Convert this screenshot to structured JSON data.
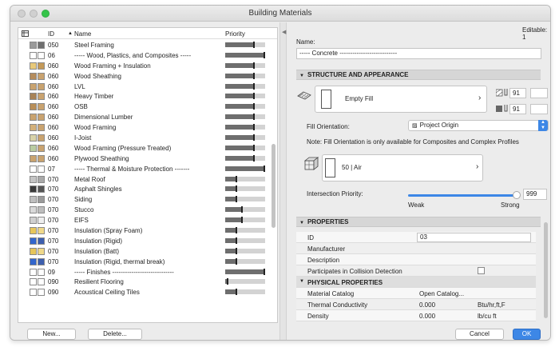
{
  "window": {
    "title": "Building Materials"
  },
  "list": {
    "headers": {
      "id": "ID",
      "name": "Name",
      "priority": "Priority"
    },
    "rows": [
      {
        "id": "050",
        "name": "Steel Framing",
        "c1": "#9a9a9a",
        "c2": "#6f6f6f",
        "p": 0.72
      },
      {
        "id": "06",
        "name": "----- Wood, Plastics, and Composites -----",
        "c1": "#ffffff",
        "c2": "#ffffff",
        "p": 0.98
      },
      {
        "id": "060",
        "name": "Wood Framing + Insulation",
        "c1": "#e8c97a",
        "c2": "#c49a59",
        "p": 0.72
      },
      {
        "id": "060",
        "name": "Wood Sheathing",
        "c1": "#b58c5c",
        "c2": "#c9a36f",
        "p": 0.72
      },
      {
        "id": "060",
        "name": "LVL",
        "c1": "#c9a36f",
        "c2": "#c9a36f",
        "p": 0.72
      },
      {
        "id": "060",
        "name": "Heavy Timber",
        "c1": "#a88256",
        "c2": "#c9a36f",
        "p": 0.72
      },
      {
        "id": "060",
        "name": "OSB",
        "c1": "#b98f59",
        "c2": "#c9a36f",
        "p": 0.72
      },
      {
        "id": "060",
        "name": "Dimensional Lumber",
        "c1": "#c9a36f",
        "c2": "#c9a36f",
        "p": 0.72
      },
      {
        "id": "060",
        "name": "Wood Framing",
        "c1": "#d3b07a",
        "c2": "#c9a36f",
        "p": 0.72
      },
      {
        "id": "060",
        "name": "I-Joist",
        "c1": "#d8d2a8",
        "c2": "#c9a36f",
        "p": 0.72
      },
      {
        "id": "060",
        "name": "Wood Framing (Pressure Treated)",
        "c1": "#b9cca1",
        "c2": "#c9a36f",
        "p": 0.72
      },
      {
        "id": "060",
        "name": "Plywood Sheathing",
        "c1": "#c9a36f",
        "c2": "#c9a36f",
        "p": 0.72
      },
      {
        "id": "07",
        "name": "----- Thermal & Moisture Protection -------",
        "c1": "#ffffff",
        "c2": "#ffffff",
        "p": 0.98
      },
      {
        "id": "070",
        "name": "Metal Roof",
        "c1": "#c4c4c4",
        "c2": "#a9a9a9",
        "p": 0.28
      },
      {
        "id": "070",
        "name": "Asphalt Shingles",
        "c1": "#3b3b3b",
        "c2": "#555555",
        "p": 0.28
      },
      {
        "id": "070",
        "name": "Siding",
        "c1": "#bfbfbf",
        "c2": "#9a9a9a",
        "p": 0.28
      },
      {
        "id": "070",
        "name": "Stucco",
        "c1": "#d9d9d9",
        "c2": "#bdbdbd",
        "p": 0.42
      },
      {
        "id": "070",
        "name": "EIFS",
        "c1": "#d0d0d0",
        "c2": "#eeeeee",
        "p": 0.42
      },
      {
        "id": "070",
        "name": "Insulation (Spray Foam)",
        "c1": "#e7c65b",
        "c2": "#f0d98a",
        "p": 0.28
      },
      {
        "id": "070",
        "name": "Insulation (Rigid)",
        "c1": "#3366cc",
        "c2": "#3d5fae",
        "p": 0.28
      },
      {
        "id": "070",
        "name": "Insulation (Batt)",
        "c1": "#e6c55a",
        "c2": "#f0d98a",
        "p": 0.28
      },
      {
        "id": "070",
        "name": "Insulation (Rigid, thermal break)",
        "c1": "#3366cc",
        "c2": "#3d5fae",
        "p": 0.28
      },
      {
        "id": "09",
        "name": "----- Finishes -----------------------------",
        "c1": "#ffffff",
        "c2": "#ffffff",
        "p": 0.98
      },
      {
        "id": "090",
        "name": "Resilient Flooring",
        "c1": "#ffffff",
        "c2": "#ffffff",
        "p": 0.06
      },
      {
        "id": "090",
        "name": "Acoustical Ceiling Tiles",
        "c1": "#ffffff",
        "c2": "#ffffff",
        "p": 0.28
      }
    ],
    "buttons": {
      "new": "New...",
      "delete": "Delete..."
    }
  },
  "detail": {
    "editable": "Editable: 1",
    "name_label": "Name:",
    "name_value": "----- Concrete ---------------------------",
    "structure_header": "STRUCTURE AND APPEARANCE",
    "fill_name": "Empty Fill",
    "pen1": "91",
    "pen2": "91",
    "fill_orientation_label": "Fill Orientation:",
    "fill_orientation_value": "Project Origin",
    "note": "Note: Fill Orientation is only available for Composites and Complex Profiles",
    "surface_value": "50 | Air",
    "intersection_label": "Intersection Priority:",
    "intersection_value": "999",
    "intersection_fraction": 1.0,
    "weak_label": "Weak",
    "strong_label": "Strong",
    "properties_header": "PROPERTIES",
    "id_label": "ID",
    "id_value": "03",
    "manufacturer_label": "Manufacturer",
    "description_label": "Description",
    "collision_label": "Participates in Collision Detection",
    "physical_header": "PHYSICAL PROPERTIES",
    "catalog_label": "Material Catalog",
    "catalog_value": "Open Catalog...",
    "conductivity_label": "Thermal Conductivity",
    "conductivity_value": "0.000",
    "conductivity_unit": "Btu/hr,ft,F",
    "density_label": "Density",
    "density_value": "0.000",
    "density_unit": "lb/cu ft"
  },
  "footer": {
    "cancel": "Cancel",
    "ok": "OK"
  },
  "colors": {
    "accent": "#3d87e6"
  }
}
